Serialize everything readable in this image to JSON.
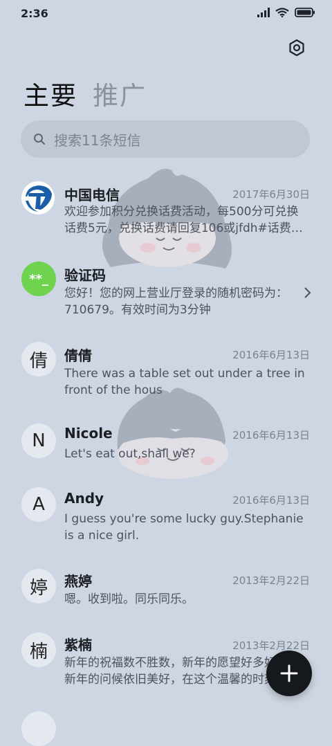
{
  "status": {
    "time": "2:36"
  },
  "tabs": [
    {
      "label": "主要"
    },
    {
      "label": "推广"
    }
  ],
  "search": {
    "placeholder": "搜索11条短信"
  },
  "messages": [
    {
      "name": "中国电信",
      "date": "2017年6月30日",
      "preview": "欢迎参加积分兑换话费活动，每500分可兑换话费5元，兑换话费请回复106或jfdh#话费…",
      "avatar": "telecom-logo"
    },
    {
      "name": "验证码",
      "date": "",
      "preview": "您好！您的网上营业厅登录的随机密码为：710679。有效时间为3分钟",
      "avatar_text": "**_"
    },
    {
      "name": "倩倩",
      "date": "2016年6月13日",
      "preview": "There was a table set out under a tree in front of the hous",
      "avatar_text": "倩"
    },
    {
      "name": "Nicole",
      "date": "2016年6月13日",
      "preview": "Let's eat out,shall we?",
      "avatar_text": "N"
    },
    {
      "name": "Andy",
      "date": "2016年6月13日",
      "preview": "I guess you're some lucky guy.Stephanie is a nice girl.",
      "avatar_text": "A"
    },
    {
      "name": "燕婷",
      "date": "2013年2月22日",
      "preview": "嗯。收到啦。同乐同乐。",
      "avatar_text": "婷"
    },
    {
      "name": "紫楠",
      "date": "2013年2月22日",
      "preview": "新年的祝福数不胜数，新年的愿望好多好多，新年的问候依旧美好，在这个温馨的时刻",
      "avatar_text": "楠"
    }
  ],
  "colors": {
    "background": "#cdd6e2",
    "verify_avatar": "#6fd34f",
    "telecom_blue": "#1a5ea8",
    "fab": "#15181c"
  }
}
